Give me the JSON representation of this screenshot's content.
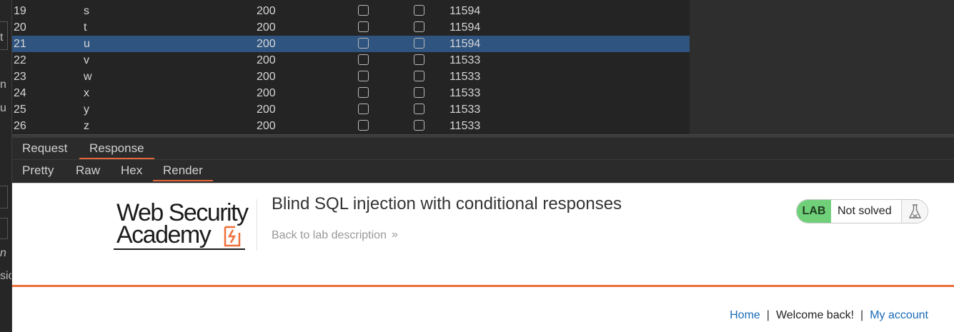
{
  "left_panel": {
    "fragments": [
      "t",
      "n",
      "u",
      "n",
      "sio"
    ]
  },
  "results": {
    "rows": [
      {
        "num": "19",
        "payload": "s",
        "status": "200",
        "length": "11594",
        "selected": false
      },
      {
        "num": "20",
        "payload": "t",
        "status": "200",
        "length": "11594",
        "selected": false
      },
      {
        "num": "21",
        "payload": "u",
        "status": "200",
        "length": "11594",
        "selected": true
      },
      {
        "num": "22",
        "payload": "v",
        "status": "200",
        "length": "11533",
        "selected": false
      },
      {
        "num": "23",
        "payload": "w",
        "status": "200",
        "length": "11533",
        "selected": false
      },
      {
        "num": "24",
        "payload": "x",
        "status": "200",
        "length": "11533",
        "selected": false
      },
      {
        "num": "25",
        "payload": "y",
        "status": "200",
        "length": "11533",
        "selected": false
      },
      {
        "num": "26",
        "payload": "z",
        "status": "200",
        "length": "11533",
        "selected": false
      }
    ]
  },
  "message_tabs": {
    "request": "Request",
    "response": "Response",
    "active": "response"
  },
  "view_tabs": {
    "pretty": "Pretty",
    "raw": "Raw",
    "hex": "Hex",
    "render": "Render",
    "active": "render"
  },
  "rendered_page": {
    "logo_line1": "Web Security",
    "logo_line2": "Academy",
    "title": "Blind SQL injection with conditional responses",
    "back_link": "Back to lab description",
    "back_chevron": "»",
    "lab_badge": "LAB",
    "status": "Not solved",
    "nav": {
      "home": "Home",
      "separator": "|",
      "welcome": "Welcome back!",
      "my_account": "My account"
    }
  },
  "colors": {
    "selected_row": "#2f5480",
    "accent_orange": "#ef6f3a",
    "lab_badge_green": "#70d07a",
    "link_blue": "#1a6bb8"
  }
}
